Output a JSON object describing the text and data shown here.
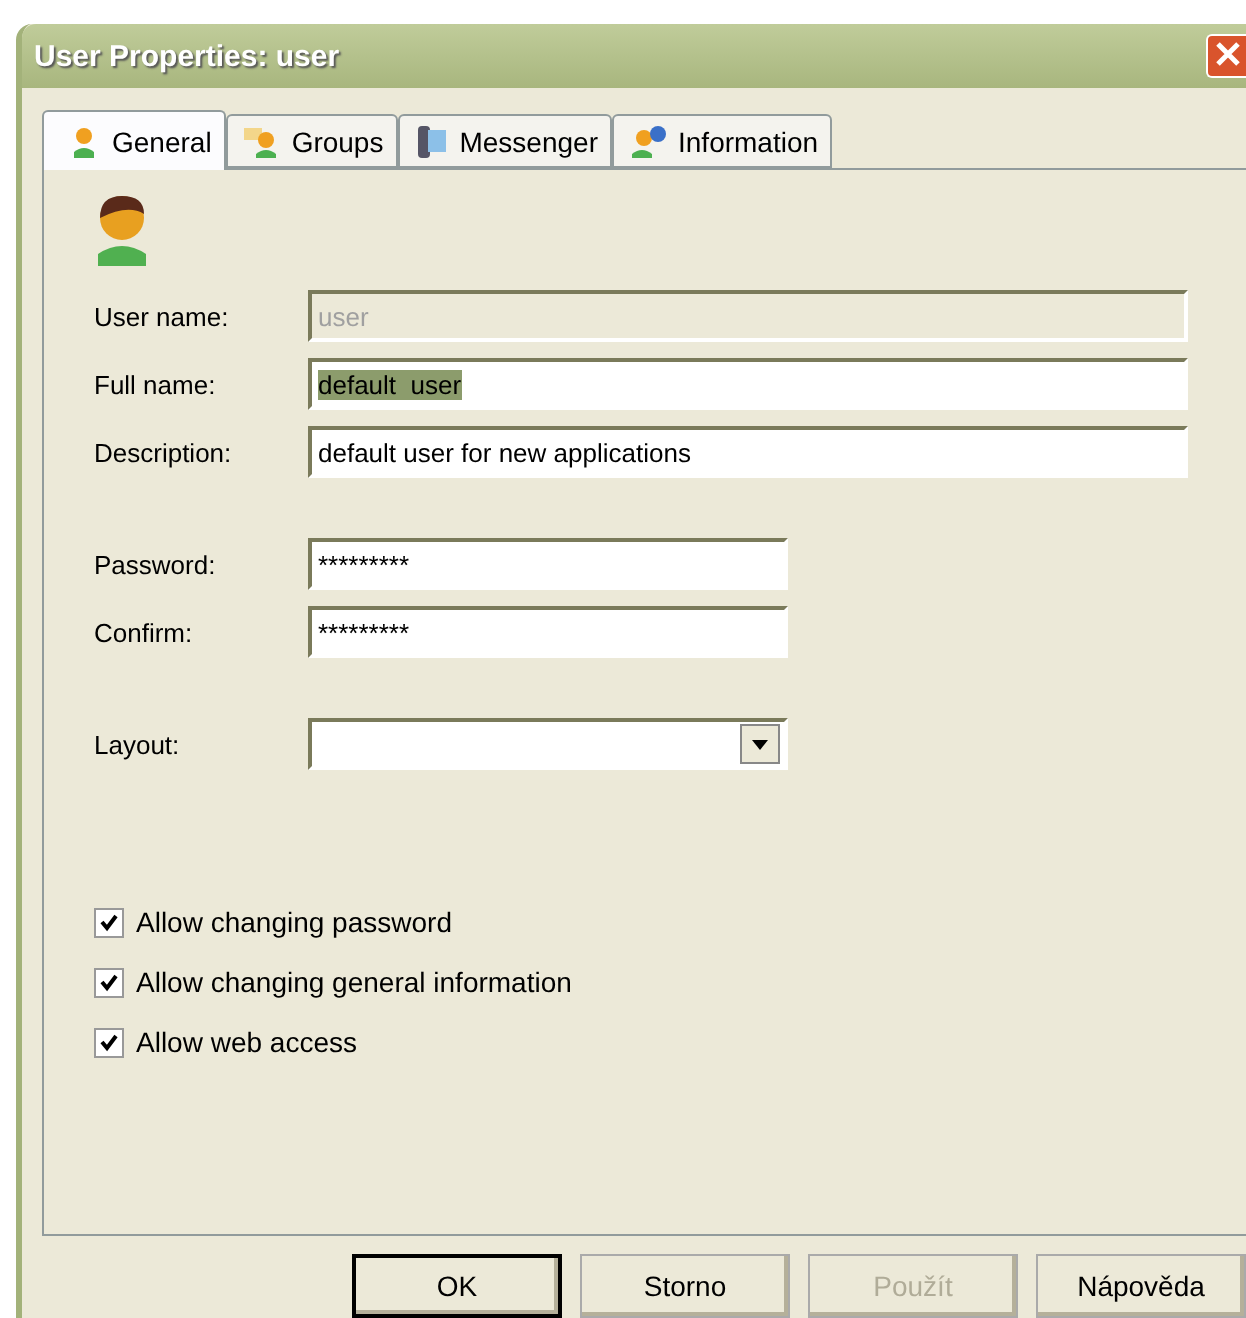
{
  "window": {
    "title": "User Properties: user"
  },
  "tabs": [
    {
      "label": "General",
      "selected": true
    },
    {
      "label": "Groups",
      "selected": false
    },
    {
      "label": "Messenger",
      "selected": false
    },
    {
      "label": "Information",
      "selected": false
    }
  ],
  "fields": [
    {
      "label": "User name:",
      "value": "user",
      "disabled": true
    },
    {
      "label": "Full name:",
      "value": "default  user",
      "disabled": false,
      "text_selected": true
    },
    {
      "label": "Description:",
      "value": "default  user for new applications",
      "disabled": false
    },
    {
      "label": "Password:",
      "value": "*********",
      "disabled": false
    },
    {
      "label": "Confirm:",
      "value": "*********",
      "disabled": false
    }
  ],
  "layout": {
    "label": "Layout:"
  },
  "checkboxes": [
    {
      "label": "Allow changing password",
      "checked": true
    },
    {
      "label": "Allow changing general information",
      "checked": true
    },
    {
      "label": "Allow web access",
      "checked": true
    }
  ],
  "buttons": [
    {
      "label": "OK",
      "default": true,
      "disabled": false
    },
    {
      "label": "Storno",
      "default": false,
      "disabled": false
    },
    {
      "label": "Použít",
      "default": false,
      "disabled": true
    },
    {
      "label": "Nápověda",
      "default": false,
      "disabled": false
    }
  ]
}
